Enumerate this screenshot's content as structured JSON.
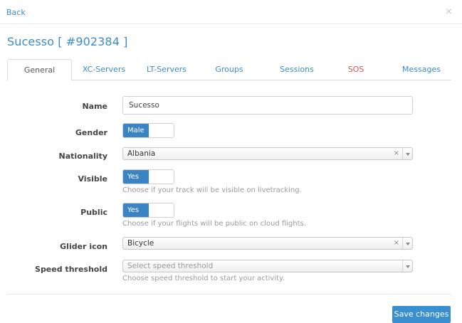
{
  "nav": {
    "back": "Back",
    "close": "×"
  },
  "title": "Sucesso [ #902384 ]",
  "tabs": [
    {
      "label": "General"
    },
    {
      "label": "XC-Servers"
    },
    {
      "label": "LT-Servers"
    },
    {
      "label": "Groups"
    },
    {
      "label": "Sessions"
    },
    {
      "label": "SOS"
    },
    {
      "label": "Messages"
    }
  ],
  "form": {
    "name": {
      "label": "Name",
      "value": "Sucesso"
    },
    "gender": {
      "label": "Gender",
      "value": "Male"
    },
    "nationality": {
      "label": "Nationality",
      "value": "Albania",
      "clear": "×"
    },
    "visible": {
      "label": "Visible",
      "value": "Yes",
      "help": "Choose if your track will be visible on livetracking."
    },
    "public": {
      "label": "Public",
      "value": "Yes",
      "help": "Choose if your flights will be public on cloud flights."
    },
    "glider_icon": {
      "label": "Glider icon",
      "value": "Bicycle",
      "clear": "×"
    },
    "speed_threshold": {
      "label": "Speed threshold",
      "placeholder": "Select speed threshold",
      "help": "Choose speed threshold to start your activity."
    }
  },
  "actions": {
    "save": "Save changes"
  },
  "colors": {
    "accent": "#3a8bc8",
    "toggle_on": "#3a84c4",
    "sos": "#d9534f"
  }
}
